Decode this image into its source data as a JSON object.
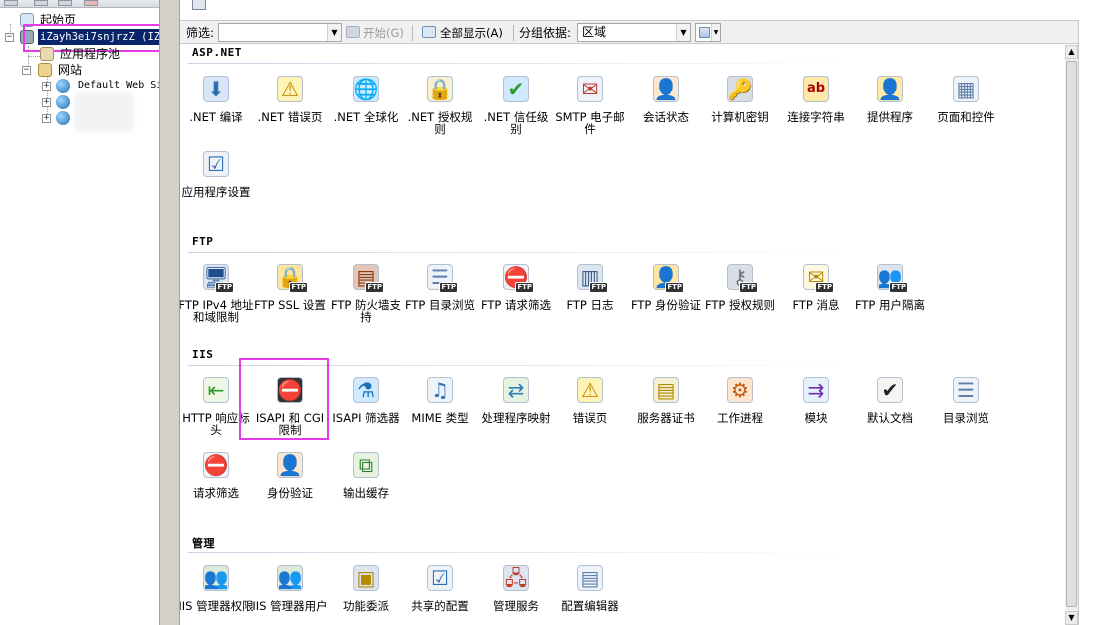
{
  "tree": {
    "start_page_label": "起始页",
    "server_label": "iZayh3ei7snjrzZ (IZA",
    "app_pools_label": "应用程序池",
    "sites_label": "网站",
    "default_site_label": "Default Web Si"
  },
  "filter_bar": {
    "filter_label": "筛选:",
    "filter_value": "",
    "start_button": "开始(G)",
    "show_all_button": "全部显示(A)",
    "group_by_label": "分组依据:",
    "group_by_value": "区域"
  },
  "colors": {
    "highlight": "#e63ce6",
    "selection": "#0a246a"
  },
  "sections": [
    {
      "title": "ASP.NET",
      "features": [
        {
          "label": ".NET 编译",
          "icon": "download-arrow-icon"
        },
        {
          "label": ".NET 错误页",
          "icon": "warning-404-icon"
        },
        {
          "label": ".NET 全球化",
          "icon": "globe-icon"
        },
        {
          "label": ".NET 授权规则",
          "icon": "lock-document-icon"
        },
        {
          "label": ".NET 信任级别",
          "icon": "globe-check-icon"
        },
        {
          "label": "SMTP 电子邮件",
          "icon": "mail-icon"
        },
        {
          "label": "会话状态",
          "icon": "user-session-icon"
        },
        {
          "label": "计算机密钥",
          "icon": "server-key-icon"
        },
        {
          "label": "连接字符串",
          "icon": "database-ab-icon"
        },
        {
          "label": "提供程序",
          "icon": "provider-user-icon"
        },
        {
          "label": "页面和控件",
          "icon": "page-controls-icon"
        },
        {
          "label": "应用程序设置",
          "icon": "app-settings-icon"
        }
      ]
    },
    {
      "title": "FTP",
      "features": [
        {
          "label": "FTP IPv4 地址和域限制",
          "icon": "ftp-monitor-icon"
        },
        {
          "label": "FTP SSL 设置",
          "icon": "ftp-lock-icon"
        },
        {
          "label": "FTP 防火墙支持",
          "icon": "ftp-firewall-icon"
        },
        {
          "label": "FTP 目录浏览",
          "icon": "ftp-directory-icon"
        },
        {
          "label": "FTP 请求筛选",
          "icon": "ftp-request-filter-icon"
        },
        {
          "label": "FTP 日志",
          "icon": "ftp-log-icon"
        },
        {
          "label": "FTP 身份验证",
          "icon": "ftp-auth-icon"
        },
        {
          "label": "FTP 授权规则",
          "icon": "ftp-keys-icon"
        },
        {
          "label": "FTP 消息",
          "icon": "ftp-message-icon"
        },
        {
          "label": "FTP 用户隔离",
          "icon": "ftp-user-isolation-icon"
        }
      ]
    },
    {
      "title": "IIS",
      "features": [
        {
          "label": "HTTP 响应标头",
          "icon": "http-header-icon"
        },
        {
          "label": "ISAPI 和 CGI 限制",
          "icon": "isapi-cgi-icon"
        },
        {
          "label": "ISAPI 筛选器",
          "icon": "isapi-filter-icon"
        },
        {
          "label": "MIME 类型",
          "icon": "mime-music-icon"
        },
        {
          "label": "处理程序映射",
          "icon": "handler-mapping-icon"
        },
        {
          "label": "错误页",
          "icon": "error-page-icon"
        },
        {
          "label": "服务器证书",
          "icon": "certificate-icon"
        },
        {
          "label": "工作进程",
          "icon": "worker-process-icon"
        },
        {
          "label": "模块",
          "icon": "modules-icon"
        },
        {
          "label": "默认文档",
          "icon": "default-document-icon"
        },
        {
          "label": "目录浏览",
          "icon": "directory-browse-icon"
        },
        {
          "label": "请求筛选",
          "icon": "request-filter-icon"
        },
        {
          "label": "身份验证",
          "icon": "authentication-icon"
        },
        {
          "label": "输出缓存",
          "icon": "output-cache-icon"
        }
      ]
    },
    {
      "title": "管理",
      "features": [
        {
          "label": "IIS 管理器权限",
          "icon": "iis-manager-permissions-icon"
        },
        {
          "label": "IIS 管理器用户",
          "icon": "iis-manager-users-icon"
        },
        {
          "label": "功能委派",
          "icon": "feature-delegation-icon"
        },
        {
          "label": "共享的配置",
          "icon": "shared-config-icon"
        },
        {
          "label": "管理服务",
          "icon": "management-service-icon"
        },
        {
          "label": "配置编辑器",
          "icon": "config-editor-icon"
        }
      ]
    }
  ]
}
